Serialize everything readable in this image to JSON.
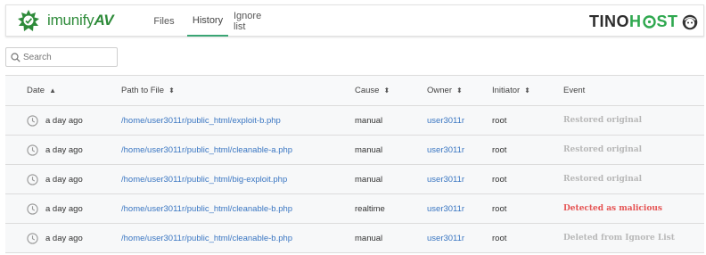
{
  "header": {
    "logo_text_light": "imunify",
    "logo_text_bold": "AV",
    "tabs": [
      {
        "label": "Files"
      },
      {
        "label": "History"
      },
      {
        "label": "Ignore list"
      }
    ],
    "active_tab": "History",
    "brand_text_a": "TINO",
    "brand_text_b": "H",
    "brand_text_c": "ST",
    "accent_color": "#3aa574",
    "logo_color": "#2e8b3a"
  },
  "search": {
    "placeholder": "Search",
    "value": ""
  },
  "table": {
    "columns": [
      {
        "label": "Date",
        "sort": "▲"
      },
      {
        "label": "Path to File",
        "sort": "⬍"
      },
      {
        "label": "Cause",
        "sort": "⬍"
      },
      {
        "label": "Owner",
        "sort": "⬍"
      },
      {
        "label": "Initiator",
        "sort": "⬍"
      },
      {
        "label": "Event",
        "sort": ""
      }
    ],
    "rows": [
      {
        "date": "a day ago",
        "path": "/home/user3011r/public_html/exploit-b.php",
        "cause": "manual",
        "owner": "user3011r",
        "initiator": "root",
        "event": "Restored original"
      },
      {
        "date": "a day ago",
        "path": "/home/user3011r/public_html/cleanable-a.php",
        "cause": "manual",
        "owner": "user3011r",
        "initiator": "root",
        "event": "Restored original"
      },
      {
        "date": "a day ago",
        "path": "/home/user3011r/public_html/big-exploit.php",
        "cause": "manual",
        "owner": "user3011r",
        "initiator": "root",
        "event": "Restored original"
      },
      {
        "date": "a day ago",
        "path": "/home/user3011r/public_html/cleanable-b.php",
        "cause": "realtime",
        "owner": "user3011r",
        "initiator": "root",
        "event": "Detected as malicious"
      },
      {
        "date": "a day ago",
        "path": "/home/user3011r/public_html/cleanable-b.php",
        "cause": "manual",
        "owner": "user3011r",
        "initiator": "root",
        "event": "Deleted from Ignore List"
      }
    ],
    "danger_color": "#e55353",
    "muted_color": "#b8b8b8",
    "link_color": "#3a76c2"
  },
  "icons": {
    "logo": "imunify-logo-icon",
    "search": "search-icon",
    "clock": "clock-icon",
    "avatar": "user-avatar-icon"
  }
}
